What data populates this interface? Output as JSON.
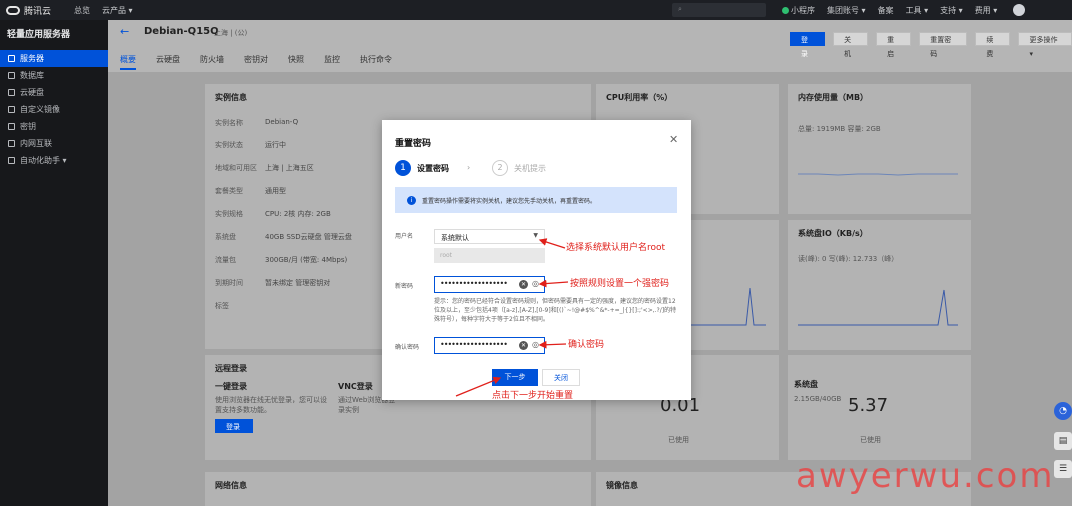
{
  "topbar": {
    "brand": "腾讯云",
    "nav": [
      "总览",
      "云产品 ▾"
    ],
    "right": [
      "小程序",
      "集团账号 ▾",
      "备案",
      "工具 ▾",
      "支持 ▾",
      "费用 ▾"
    ]
  },
  "sidebar": {
    "title": "轻量应用服务器",
    "items": [
      {
        "label": "服务器",
        "active": true
      },
      {
        "label": "数据库",
        "active": false
      },
      {
        "label": "云硬盘",
        "active": false
      },
      {
        "label": "自定义镜像",
        "active": false
      },
      {
        "label": "密钥",
        "active": false
      },
      {
        "label": "内网互联",
        "active": false
      },
      {
        "label": "自动化助手 ▾",
        "active": false
      }
    ]
  },
  "pagehead": {
    "back": "←",
    "name": "Debian-Q15Q",
    "region": "上海 | (公)",
    "actions": [
      "登录",
      "关机",
      "重启",
      "重置密码",
      "续费",
      "更多操作 ▾"
    ],
    "tabs": [
      "概要",
      "云硬盘",
      "防火墙",
      "密钥对",
      "快照",
      "监控",
      "执行命令"
    ]
  },
  "background": {
    "instance_title": "实例信息",
    "instance_rows": [
      {
        "k": "实例名称",
        "v": "Debian-Q"
      },
      {
        "k": "实例状态",
        "v": "运行中"
      },
      {
        "k": "地域和可用区",
        "v": "上海 | 上海五区"
      },
      {
        "k": "套餐类型",
        "v": "通用型"
      },
      {
        "k": "实例规格",
        "v": "CPU: 2核 内存: 2GB"
      },
      {
        "k": "系统盘",
        "v": "40GB SSD云硬盘 管理云盘"
      },
      {
        "k": "流量包",
        "v": "300GB/月 (带宽: 4Mbps)"
      },
      {
        "k": "到期时间",
        "v": "暂未绑定 管理密钥对"
      },
      {
        "k": "标签",
        "v": ""
      }
    ],
    "cpu_title": "CPU利用率（%）",
    "mem_title": "内存使用量（MB）",
    "mem_line": "总量: 1919MB  容量: 2GB",
    "io_title": "系统盘IO（KB/s）",
    "io_line": "读(峰): 0  写(峰): 12.733（峰）",
    "remote_title": "远程登录",
    "one_click": "一键登录",
    "one_click_desc": "使用浏览器在线无忧登录，您可以设置支持多数功能。",
    "login_btn": "登录",
    "vnc": "VNC登录",
    "vnc_desc": "通过Web浏览器登录实例",
    "disk_title": "系统盘",
    "disk_sub": "2.15GB/40GB",
    "disk_value": "5.37",
    "traffic_value": "0.01",
    "used_label": "已使用",
    "network_title": "网络信息",
    "image_title": "镜像信息"
  },
  "dialog": {
    "title": "重置密码",
    "close": "✕",
    "step1": {
      "num": "1",
      "label": "设置密码"
    },
    "step_sep": "›",
    "step2": {
      "num": "2",
      "label": "关机提示"
    },
    "alert": "重置密码操作需要将实例关机，建议您先手动关机，再重置密码。",
    "username_label": "用户名",
    "username_value": "系统默认",
    "username_sub": "root",
    "newpw_label": "新密码",
    "newpw_value": "••••••••••••••••••",
    "hint": "提示：您的密码已经符合设置密码规则，但密码需要具有一定的强度，建议您的密码设置12位及以上，至少包括4项（[a-z],[A-Z],[0-9]和[()`~!@#$%^&*-+=_|{}[]:;'<>,.?/]的特殊符号），每种字符大于等于2位且不相同。",
    "confirm_label": "确认密码",
    "confirm_value": "••••••••••••••••••",
    "next": "下一步",
    "cancel": "关闭"
  },
  "annotations": {
    "a1": "选择系统默认用户名root",
    "a2": "按照规则设置一个强密码",
    "a3": "确认密码",
    "a4": "点击下一步开始重置"
  },
  "watermark": "awyerwu.com",
  "colors": {
    "accent": "#0052d9",
    "annotation": "#e0201b"
  }
}
